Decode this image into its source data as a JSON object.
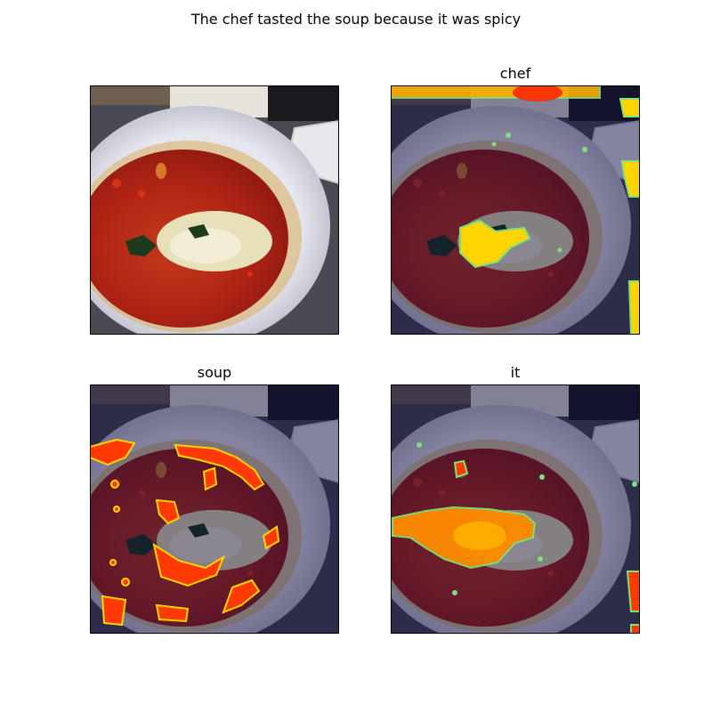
{
  "figure": {
    "title": "The chef tasted the soup because it was spicy"
  },
  "panels": [
    {
      "title": "",
      "overlay": "none"
    },
    {
      "title": "chef",
      "overlay": "attention-heatmap"
    },
    {
      "title": "soup",
      "overlay": "attention-heatmap"
    },
    {
      "title": "it",
      "overlay": "attention-heatmap"
    }
  ],
  "colors": {
    "soup": "#b52a17",
    "bowl": "#dcdce8",
    "heat_hot": "#ff2a00",
    "heat_warm": "#ffd400",
    "heat_edge": "#7fe07a",
    "dim_overlay": "#0a0a40"
  }
}
